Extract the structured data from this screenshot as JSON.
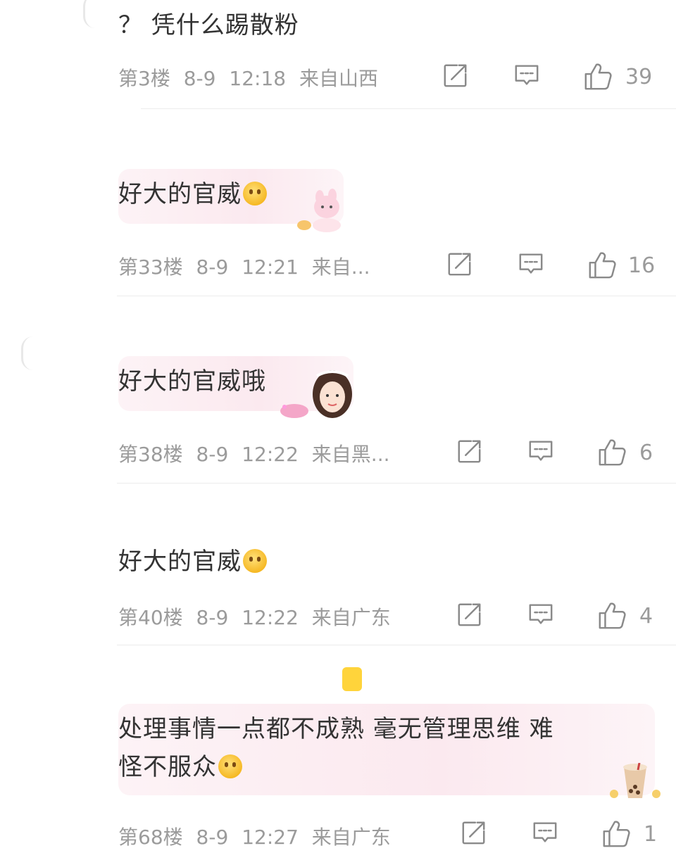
{
  "comments": [
    {
      "text": "？ 凭什么踢散粉",
      "floor": "第3楼",
      "date": "8-9",
      "time": "12:18",
      "location": "来自山西",
      "likes": "39"
    },
    {
      "text": "好大的官威",
      "floor": "第33楼",
      "date": "8-9",
      "time": "12:21",
      "location": "来自...",
      "likes": "16"
    },
    {
      "text": "好大的官威哦",
      "floor": "第38楼",
      "date": "8-9",
      "time": "12:22",
      "location": "来自黑...",
      "likes": "6"
    },
    {
      "text": "好大的官威",
      "floor": "第40楼",
      "date": "8-9",
      "time": "12:22",
      "location": "来自广东",
      "likes": "4"
    },
    {
      "text_line1": "处理事情一点都不成熟 毫无管理思维 难",
      "text_line2": "怪不服众",
      "floor": "第68楼",
      "date": "8-9",
      "time": "12:27",
      "location": "来自广东",
      "likes": "1"
    }
  ],
  "icons": {
    "share": "share-icon",
    "reply": "comment-icon",
    "like": "thumbs-up-icon"
  },
  "colors": {
    "text": "#333333",
    "meta": "#9b9b9b",
    "bubble": "#fbe9ef",
    "divider": "#ececec"
  }
}
